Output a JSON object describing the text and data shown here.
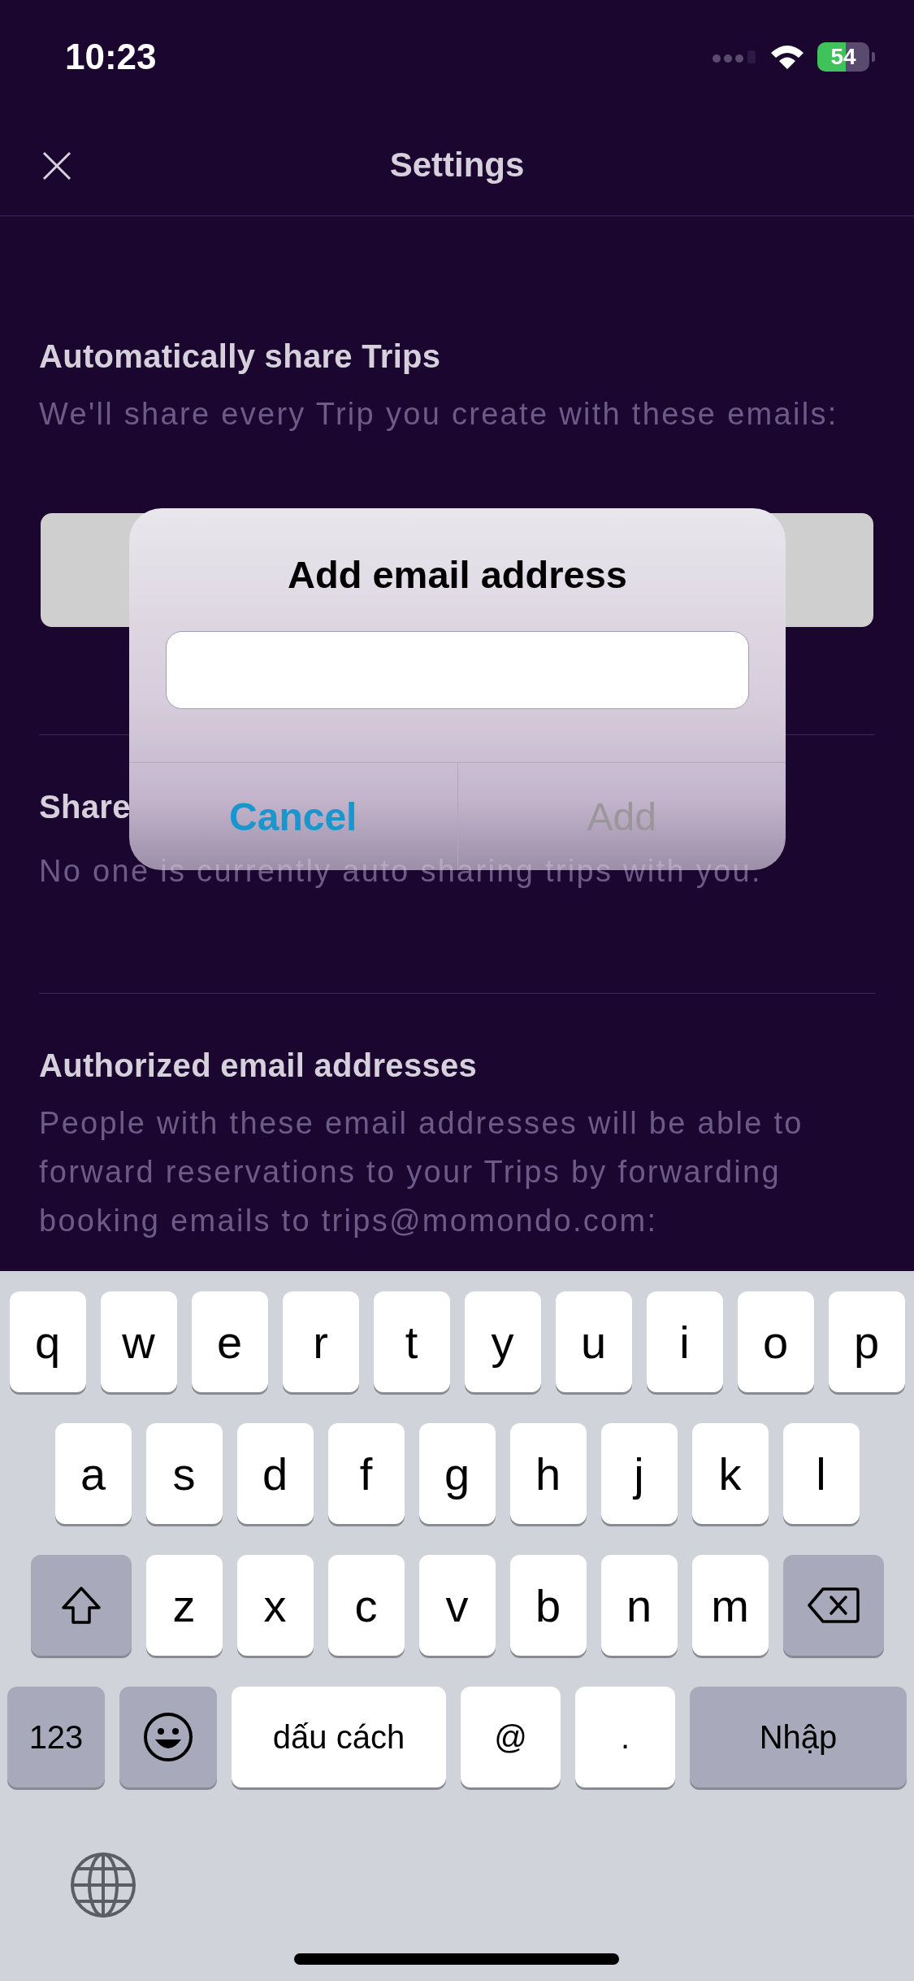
{
  "status_bar": {
    "time": "10:23",
    "battery": "54"
  },
  "header": {
    "title": "Settings"
  },
  "sections": [
    {
      "kind": "with_box",
      "title": "Automatically share Trips",
      "description": "We'll share every Trip you create with these emails:"
    },
    {
      "kind": "plain",
      "title": "Share",
      "description": "No one is currently auto sharing trips with you."
    },
    {
      "kind": "plain",
      "title": "Authorized email addresses",
      "description": "People with these email addresses will be able to forward reservations to your Trips by forwarding booking emails to trips@momondo.com:"
    }
  ],
  "dialog": {
    "title": "Add email address",
    "buttons": [
      {
        "label": "Cancel",
        "disabled": false
      },
      {
        "label": "Add",
        "disabled": true
      }
    ]
  },
  "keyboard": {
    "rows": [
      {
        "keys": [
          {
            "kind": "letter",
            "label": "q"
          },
          {
            "kind": "letter",
            "label": "w"
          },
          {
            "kind": "letter",
            "label": "e"
          },
          {
            "kind": "letter",
            "label": "r"
          },
          {
            "kind": "letter",
            "label": "t"
          },
          {
            "kind": "letter",
            "label": "y"
          },
          {
            "kind": "letter",
            "label": "u"
          },
          {
            "kind": "letter",
            "label": "i"
          },
          {
            "kind": "letter",
            "label": "o"
          },
          {
            "kind": "letter",
            "label": "p"
          }
        ]
      },
      {
        "keys": [
          {
            "kind": "letter",
            "label": "a"
          },
          {
            "kind": "letter",
            "label": "s"
          },
          {
            "kind": "letter",
            "label": "d"
          },
          {
            "kind": "letter",
            "label": "f"
          },
          {
            "kind": "letter",
            "label": "g"
          },
          {
            "kind": "letter",
            "label": "h"
          },
          {
            "kind": "letter",
            "label": "j"
          },
          {
            "kind": "letter",
            "label": "k"
          },
          {
            "kind": "letter",
            "label": "l"
          }
        ]
      },
      {
        "keys": [
          {
            "kind": "shift"
          },
          {
            "kind": "letter",
            "label": "z"
          },
          {
            "kind": "letter",
            "label": "x"
          },
          {
            "kind": "letter",
            "label": "c"
          },
          {
            "kind": "letter",
            "label": "v"
          },
          {
            "kind": "letter",
            "label": "b"
          },
          {
            "kind": "letter",
            "label": "n"
          },
          {
            "kind": "letter",
            "label": "m"
          },
          {
            "kind": "delete"
          }
        ]
      },
      {
        "keys": [
          {
            "kind": "mode",
            "label": "123"
          },
          {
            "kind": "emoji"
          },
          {
            "kind": "space",
            "label": "dấu cách"
          },
          {
            "kind": "symbol",
            "label": "@"
          },
          {
            "kind": "symbol",
            "label": "."
          },
          {
            "kind": "return",
            "label": "Nhập"
          }
        ]
      }
    ]
  }
}
